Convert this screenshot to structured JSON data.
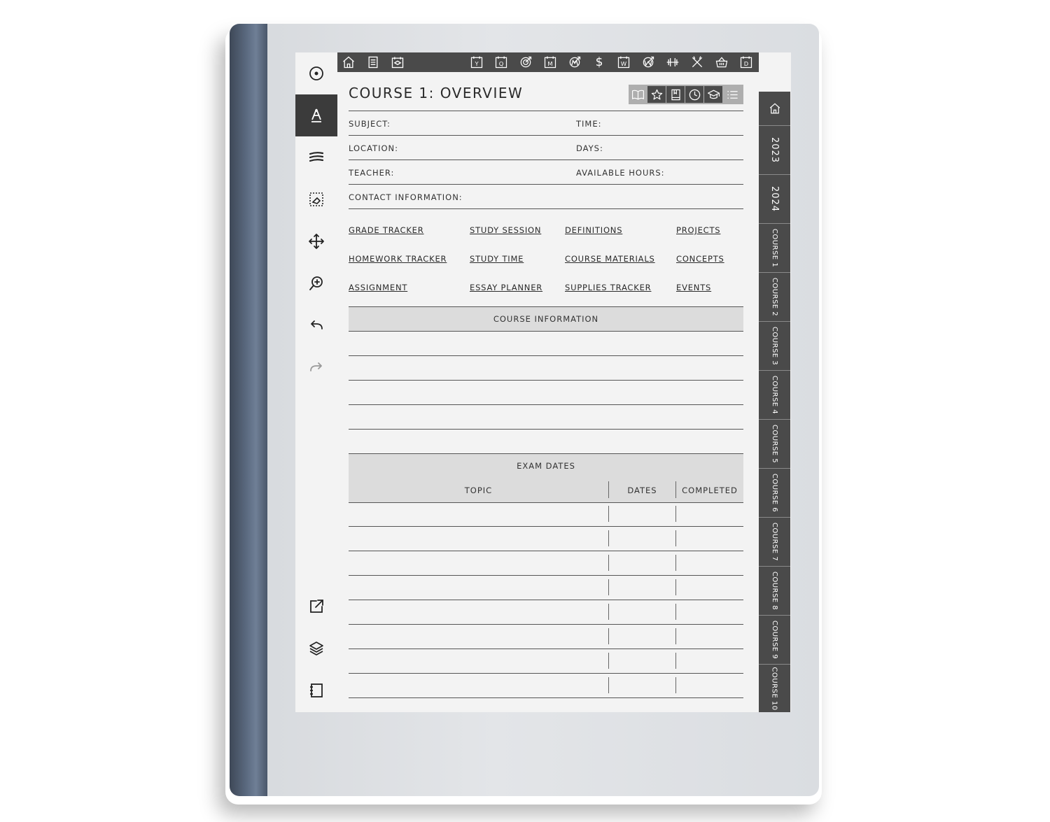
{
  "page": {
    "title": "COURSE 1: OVERVIEW",
    "fields": {
      "subject": "SUBJECT:",
      "time": "TIME:",
      "location": "LOCATION:",
      "days": "DAYS:",
      "teacher": "TEACHER:",
      "available_hours": "AVAILABLE HOURS:",
      "contact": "CONTACT INFORMATION:"
    },
    "links": [
      [
        "GRADE TRACKER",
        "STUDY SESSION",
        "DEFINITIONS",
        "PROJECTS"
      ],
      [
        "HOMEWORK TRACKER",
        "STUDY TIME",
        "COURSE MATERIALS",
        "CONCEPTS"
      ],
      [
        "ASSIGNMENT",
        "ESSAY PLANNER",
        "SUPPLIES TRACKER",
        "EVENTS"
      ]
    ],
    "course_info_header": "COURSE INFORMATION",
    "exam_header": "EXAM DATES",
    "exam_columns": [
      "TOPIC",
      "DATES",
      "COMPLETED"
    ]
  },
  "top_nav": {
    "icons": [
      "home-icon",
      "notes-icon",
      "calendar-cap-icon",
      "year-icon",
      "quarter-icon",
      "goals-icon",
      "month-icon",
      "monthly-goals-icon",
      "finance-icon",
      "week-icon",
      "weekly-goals-icon",
      "fitness-icon",
      "tools-icon",
      "basket-icon",
      "day-icon"
    ],
    "letters": {
      "year": "Y",
      "quarter": "Q",
      "month": "M",
      "week": "W",
      "day": "D",
      "dollar": "$"
    }
  },
  "section_icons": [
    "book-icon",
    "star-icon",
    "notebook-icon",
    "clock-icon",
    "graduation-icon",
    "list-icon"
  ],
  "side_tabs": {
    "home": "home-icon",
    "years": [
      "2023",
      "2024"
    ],
    "courses": [
      "COURSE 1",
      "COURSE 2",
      "COURSE 3",
      "COURSE 4",
      "COURSE 5",
      "COURSE 6",
      "COURSE 7",
      "COURSE 8",
      "COURSE 9",
      "COURSE 10"
    ]
  },
  "left_toolbar": [
    "menu-circle-icon",
    "pen-tool-icon",
    "lines-icon",
    "eraser-select-icon",
    "move-icon",
    "zoom-icon",
    "undo-icon",
    "redo-icon",
    "share-icon",
    "layers-icon",
    "notebook-icon"
  ],
  "colors": {
    "dark": "#4a4a4a",
    "screen": "#f3f3f3",
    "band": "#dcdcdc",
    "spine": "#5b6a80"
  }
}
